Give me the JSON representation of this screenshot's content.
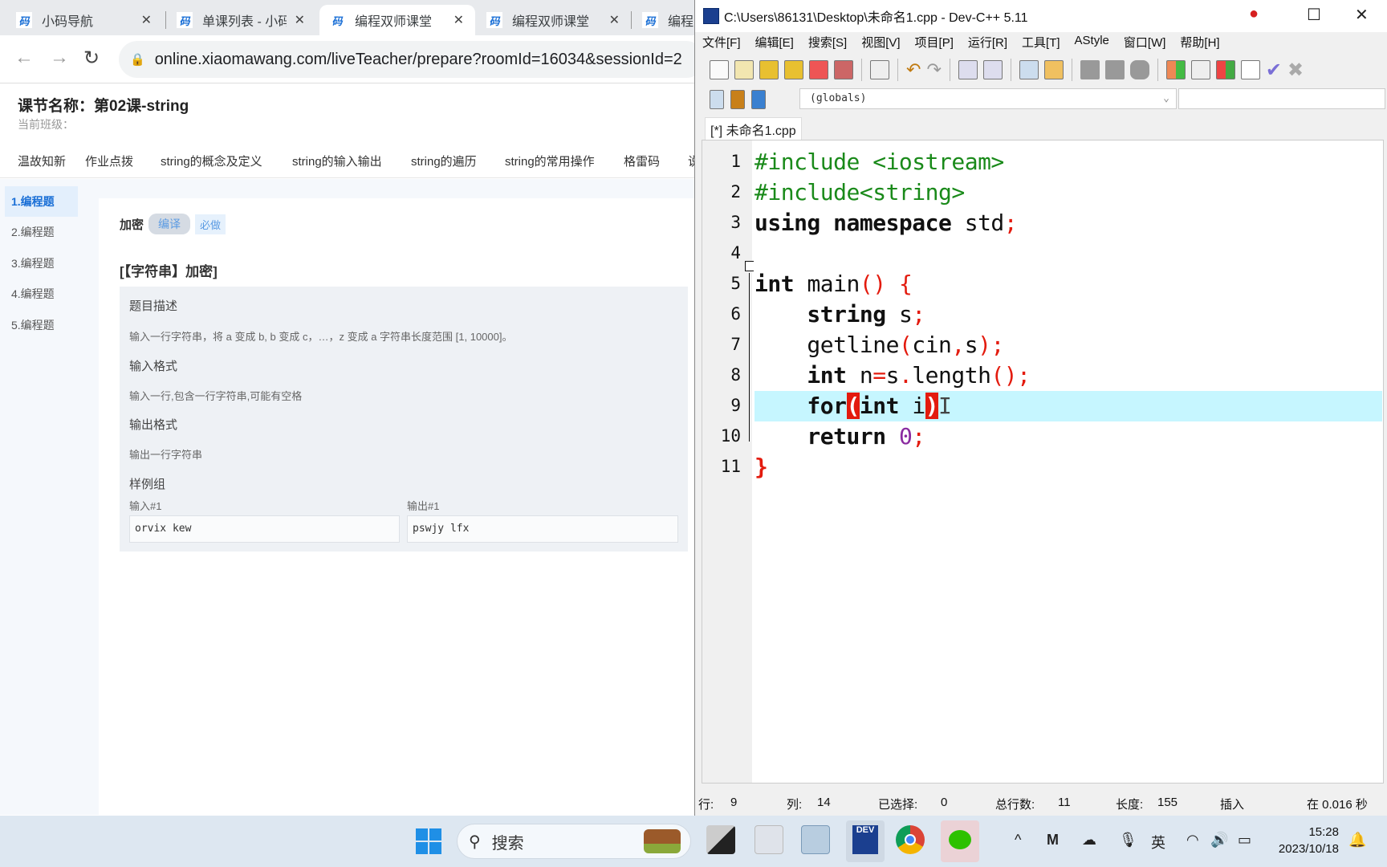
{
  "browser": {
    "tabs": [
      {
        "label": "小码导航",
        "active": false
      },
      {
        "label": "单课列表 - 小码",
        "active": false
      },
      {
        "label": "编程双师课堂",
        "active": true
      },
      {
        "label": "编程双师课堂",
        "active": false
      },
      {
        "label": "编程",
        "active": false
      }
    ],
    "favicon_text": "码",
    "url": "online.xiaomawang.com/liveTeacher/prepare?roomId=16034&sessionId=2"
  },
  "page": {
    "title": "课节名称：第02课-string",
    "class_label": "当前班级：",
    "lesson_tabs": [
      "温故知新",
      "作业点拨",
      "string的概念及定义",
      "string的输入输出",
      "string的遍历",
      "string的常用操作",
      "格雷码",
      "说"
    ],
    "sidebar": [
      {
        "label": "1.编程题",
        "active": true
      },
      {
        "label": "2.编程题"
      },
      {
        "label": "3.编程题"
      },
      {
        "label": "4.编程题"
      },
      {
        "label": "5.编程题"
      }
    ],
    "question": {
      "name": "加密",
      "tag1": "编译",
      "tag2": "必做",
      "title": "[【字符串】加密]",
      "desc_h": "题目描述",
      "desc": "输入一行字符串，将 a 变成 b, b 变成 c，…，z 变成 a 字符串长度范围 [1, 10000]。",
      "in_h": "输入格式",
      "in": "输入一行,包含一行字符串,可能有空格",
      "out_h": "输出格式",
      "out": "输出一行字符串",
      "sample_h": "样例组",
      "sample_in_label": "输入#1",
      "sample_out_label": "输出#1",
      "sample_in": "orvix kew",
      "sample_out": "pswjy lfx"
    }
  },
  "devcpp": {
    "title": "C:\\Users\\86131\\Desktop\\未命名1.cpp - Dev-C++ 5.11",
    "menu": [
      "文件[F]",
      "编辑[E]",
      "搜索[S]",
      "视图[V]",
      "项目[P]",
      "运行[R]",
      "工具[T]",
      "AStyle",
      "窗口[W]",
      "帮助[H]"
    ],
    "scope": "(globals)",
    "file_tab": "[*] 未命名1.cpp",
    "code_lines": [
      "1",
      "2",
      "3",
      "4",
      "5",
      "6",
      "7",
      "8",
      "9",
      "10",
      "11"
    ],
    "code": {
      "l1": "#include <iostream>",
      "l2": "#include<string>",
      "l3a": "using namespace ",
      "l3b": "std",
      "l3c": ";",
      "l5a": "int ",
      "l5b": "main",
      "l5c": "() {",
      "l6a": "    string ",
      "l6b": "s",
      "l6c": ";",
      "l7a": "    getline",
      "l7b": "(",
      "l7c": "cin",
      "l7d": ",",
      "l7e": "s",
      "l7f": ");",
      "l8a": "    int ",
      "l8b": "n",
      "l8c": "=",
      "l8d": "s",
      "l8e": ".",
      "l8f": "length",
      "l8g": "();",
      "l9a": "    for",
      "l9b": "(",
      "l9c": "int ",
      "l9d": "i",
      "l9e": ")",
      "l10a": "    return ",
      "l10b": "0",
      "l10c": ";",
      "l11": "}"
    },
    "status": {
      "row_label": "行:",
      "row": "9",
      "col_label": "列:",
      "col": "14",
      "sel_label": "已选择:",
      "sel": "0",
      "lines_label": "总行数:",
      "lines": "11",
      "len_label": "长度:",
      "len": "155",
      "mode": "插入",
      "time": "在 0.016 秒"
    }
  },
  "taskbar": {
    "search": "搜索",
    "tray_lang": "英",
    "time": "15:28",
    "date": "2023/10/18"
  },
  "colors": {
    "keyword": "#111111",
    "preprocessor": "#1a8a1a",
    "symbol": "#e31b0e",
    "number": "#8a2ba0",
    "highlight": "#c6f6ff",
    "accent": "#1a6fd6"
  }
}
